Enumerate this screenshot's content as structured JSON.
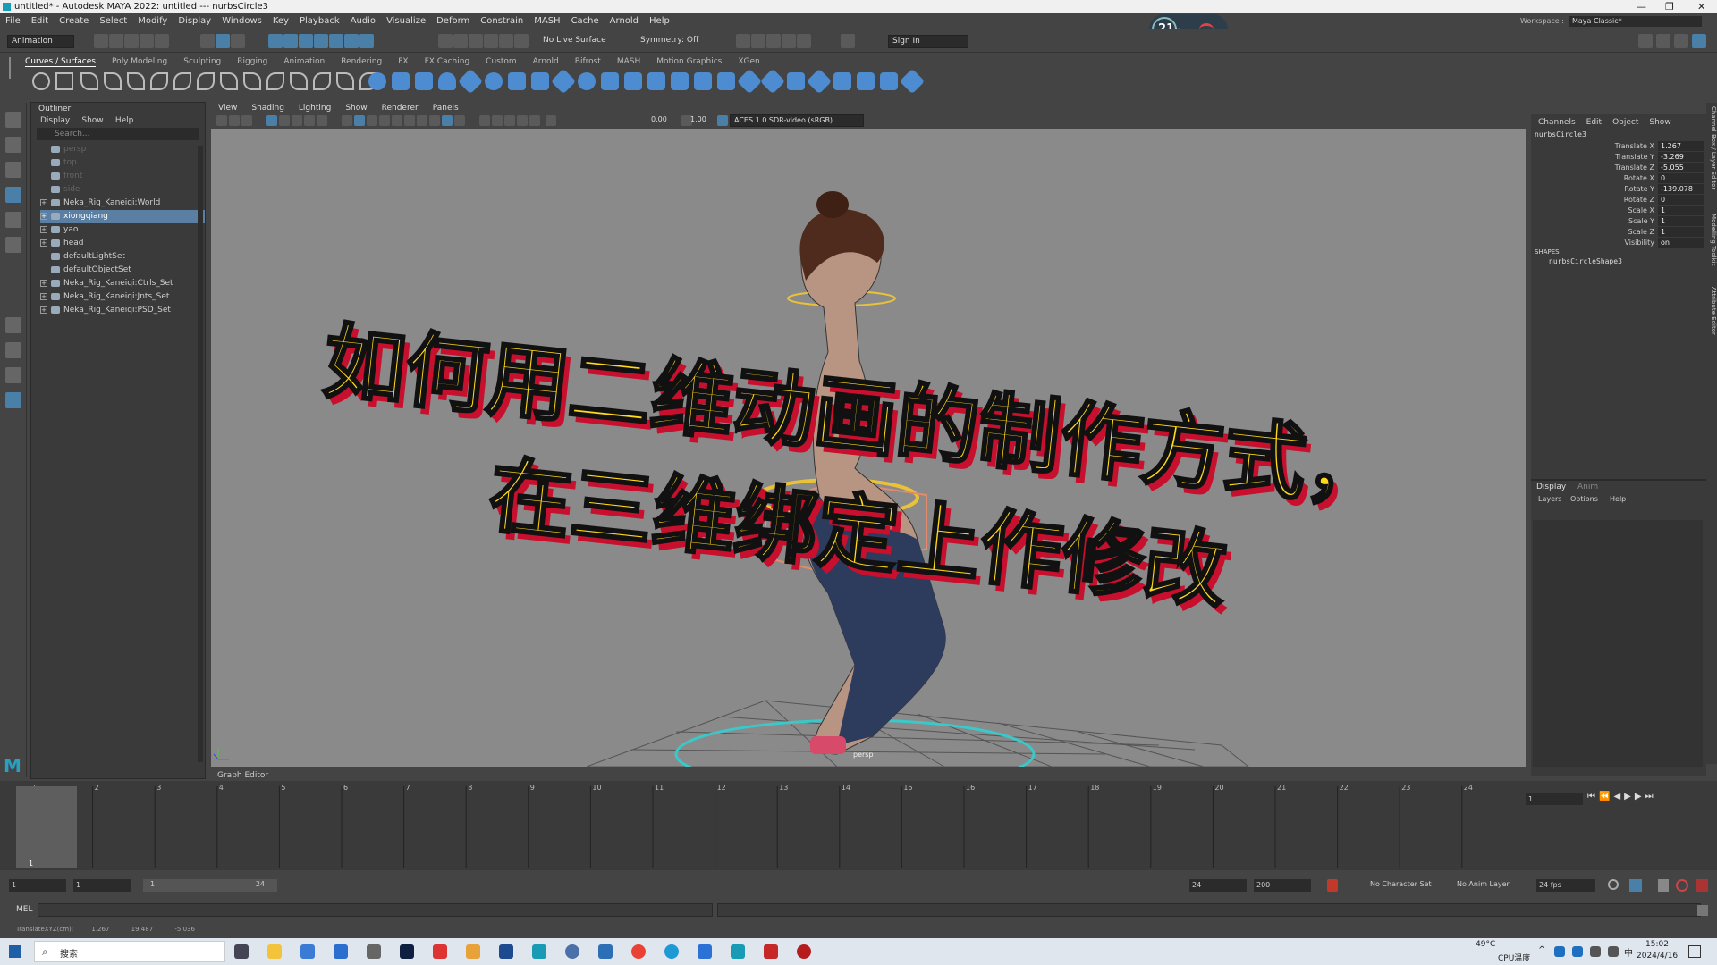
{
  "window": {
    "title": "untitled* - Autodesk MAYA 2022: untitled   ---   nurbsCircle3",
    "controls": [
      "—",
      "❐",
      "✕"
    ]
  },
  "menubar": [
    "File",
    "Edit",
    "Create",
    "Select",
    "Modify",
    "Display",
    "Windows",
    "Key",
    "Playback",
    "Audio",
    "Visualize",
    "Deform",
    "Constrain",
    "MASH",
    "Cache",
    "Arnold",
    "Help"
  ],
  "hud": {
    "fps": "21",
    "unit": "%"
  },
  "workspace": {
    "label": "Workspace :",
    "value": "Maya Classic*"
  },
  "toolbar": {
    "menuset": "Animation",
    "live_surface": "No Live Surface",
    "symmetry": "Symmetry: Off",
    "sign_in": "Sign In"
  },
  "shelf_tabs": [
    "Curves / Surfaces",
    "Poly Modeling",
    "Sculpting",
    "Rigging",
    "Animation",
    "Rendering",
    "FX",
    "FX Caching",
    "Custom",
    "Arnold",
    "Bifrost",
    "MASH",
    "Motion Graphics",
    "XGen"
  ],
  "outliner": {
    "title": "Outliner",
    "menus": [
      "Display",
      "Show",
      "Help"
    ],
    "search_placeholder": "Search...",
    "items": [
      {
        "label": "persp",
        "dim": true,
        "exp": false
      },
      {
        "label": "top",
        "dim": true,
        "exp": false
      },
      {
        "label": "front",
        "dim": true,
        "exp": false
      },
      {
        "label": "side",
        "dim": true,
        "exp": false
      },
      {
        "label": "Neka_Rig_Kaneiqi:World",
        "dim": false,
        "exp": true
      },
      {
        "label": "xiongqiang",
        "dim": false,
        "exp": true,
        "selected": true
      },
      {
        "label": "yao",
        "dim": false,
        "exp": true
      },
      {
        "label": "head",
        "dim": false,
        "exp": true
      },
      {
        "label": "defaultLightSet",
        "dim": false,
        "exp": false
      },
      {
        "label": "defaultObjectSet",
        "dim": false,
        "exp": false
      },
      {
        "label": "Neka_Rig_Kaneiqi:Ctrls_Set",
        "dim": false,
        "exp": true
      },
      {
        "label": "Neka_Rig_Kaneiqi:Jnts_Set",
        "dim": false,
        "exp": true
      },
      {
        "label": "Neka_Rig_Kaneiqi:PSD_Set",
        "dim": false,
        "exp": true
      }
    ]
  },
  "viewport": {
    "menus": [
      "View",
      "Shading",
      "Lighting",
      "Show",
      "Renderer",
      "Panels"
    ],
    "val1": "0.00",
    "val2": "1.00",
    "colorspace": "ACES 1.0 SDR-video (sRGB)",
    "camera_label": "persp",
    "overlay_line1": "如何用二维动画的制作方式，",
    "overlay_line2": "在三维绑定上作修改"
  },
  "channelbox": {
    "menus": [
      "Channels",
      "Edit",
      "Object",
      "Show"
    ],
    "object": "nurbsCircle3",
    "channels": [
      {
        "name": "Translate X",
        "value": "1.267"
      },
      {
        "name": "Translate Y",
        "value": "-3.269"
      },
      {
        "name": "Translate Z",
        "value": "-5.055"
      },
      {
        "name": "Rotate X",
        "value": "0"
      },
      {
        "name": "Rotate Y",
        "value": "-139.078"
      },
      {
        "name": "Rotate Z",
        "value": "0"
      },
      {
        "name": "Scale X",
        "value": "1"
      },
      {
        "name": "Scale Y",
        "value": "1"
      },
      {
        "name": "Scale Z",
        "value": "1"
      },
      {
        "name": "Visibility",
        "value": "on"
      }
    ],
    "shapes_label": "SHAPES",
    "shape_name": "nurbsCircleShape3",
    "layer_tabs": [
      "Display",
      "Anim"
    ],
    "layer_menus": [
      "Layers",
      "Options",
      "Help"
    ]
  },
  "side_tabs": [
    "Channel Box / Layer Editor",
    "Modelling Toolkit",
    "Attribute Editor"
  ],
  "graph_editor_label": "Graph Editor",
  "timeline": {
    "ticks": [
      "1",
      "2",
      "3",
      "4",
      "5",
      "6",
      "7",
      "8",
      "9",
      "10",
      "11",
      "12",
      "13",
      "14",
      "15",
      "16",
      "17",
      "18",
      "19",
      "20",
      "21",
      "22",
      "23",
      "24"
    ],
    "current_frame": "1"
  },
  "range": {
    "start": "1",
    "start_inner": "1",
    "slider_start": "1",
    "slider_end": "24",
    "end_inner": "24",
    "end": "200",
    "char_set": "No Character Set",
    "anim_layer": "No Anim Layer",
    "fps": "24 fps"
  },
  "mel_label": "MEL",
  "helpline": {
    "label": "TranslateXYZ(cm):",
    "x": "1.267",
    "y": "19.487",
    "z": "-5.036"
  },
  "taskbar": {
    "search_placeholder": "搜索",
    "temp": "49°C",
    "temp_label": "CPU温度",
    "time": "15:02",
    "date": "2024/4/16",
    "ime": "中"
  },
  "colors": {
    "accent": "#4a7fa8",
    "caption_fill": "#ffd91a",
    "caption_shadow": "#c8102e"
  }
}
